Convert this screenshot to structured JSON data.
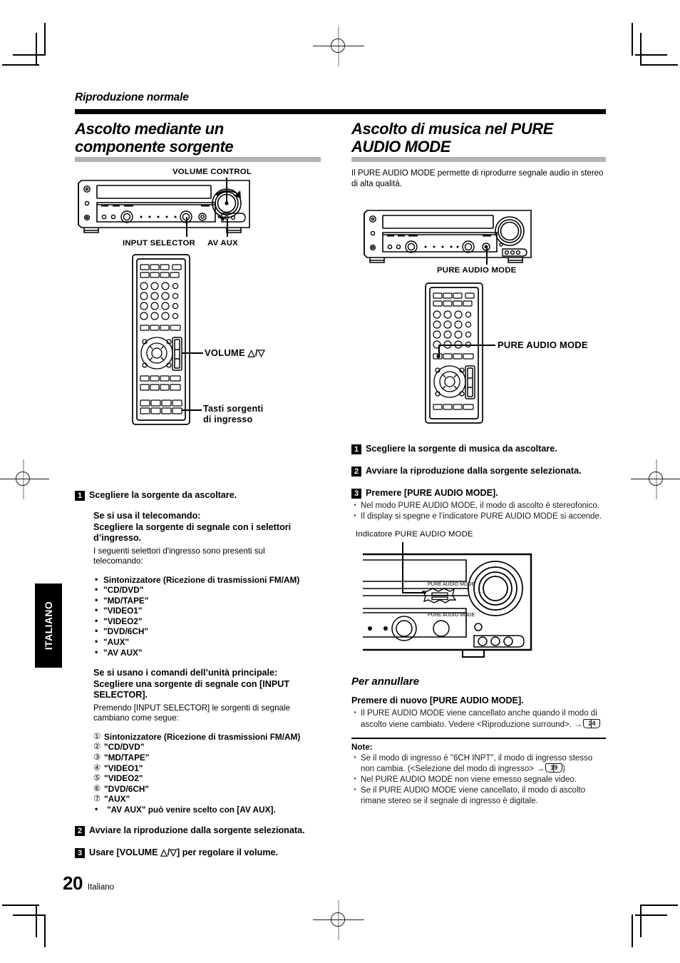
{
  "page": {
    "running_head": "Riproduzione normale",
    "folio_number": "20",
    "folio_label": "Italiano",
    "side_tab": "ITALIANO"
  },
  "left_column": {
    "title": "Ascolto mediante un\ncomponente sorgente",
    "diagram_labels": {
      "volume_control": "VOLUME CONTROL",
      "input_selector": "INPUT SELECTOR",
      "av_aux": "AV AUX",
      "volume_updown": "VOLUME △/▽",
      "source_buttons": "Tasti  sorgenti\ndi ingresso"
    },
    "step1": {
      "num": "1",
      "text": "Scegliere la sorgente da ascoltare.",
      "remote_heading": "Se si usa il telecomando:\nScegliere la sorgente di segnale con i selettori\nd’ingresso.",
      "remote_body": "I seguenti selettori d'ingresso sono presenti sul\ntelecomando:",
      "remote_items": [
        "Sintonizzatore (Ricezione di trasmissioni FM/AM)",
        "\"CD/DVD\"",
        "\"MD/TAPE\"",
        "\"VIDEO1\"",
        "\"VIDEO2\"",
        "\"DVD/6CH\"",
        "\"AUX\"",
        "\"AV AUX\""
      ],
      "unit_heading": "Se si usano i comandi dell’unità principale:\nScegliere una sorgente di segnale con [INPUT\nSELECTOR].",
      "unit_body": "Premendo [INPUT SELECTOR] le sorgenti di segnale\ncambiano come segue:",
      "unit_items": [
        {
          "marker": "①",
          "text": "Sintonizzatore (Ricezione di trasmissioni FM/AM)"
        },
        {
          "marker": "②",
          "text": "\"CD/DVD\""
        },
        {
          "marker": "③",
          "text": "\"MD/TAPE\""
        },
        {
          "marker": "④",
          "text": "\"VIDEO1\""
        },
        {
          "marker": "⑤",
          "text": "\"VIDEO2\""
        },
        {
          "marker": "⑥",
          "text": "\"DVD/6CH\""
        },
        {
          "marker": "⑦",
          "text": "\"AUX\""
        }
      ],
      "unit_last_bullet": "\"AV AUX\" può venire scelto con [AV AUX]."
    },
    "step2": {
      "num": "2",
      "text": "Avviare la riproduzione dalla sorgente selezionata."
    },
    "step3": {
      "num": "3",
      "text": "Usare [VOLUME △/▽] per regolare il volume."
    }
  },
  "right_column": {
    "title": "Ascolto di musica nel PURE\nAUDIO MODE",
    "intro": "Il PURE AUDIO MODE permette di riprodurre segnale audio in\nstereo di alta qualità.",
    "diagram_labels": {
      "pure_audio_mode_unit": "PURE AUDIO MODE",
      "pure_audio_mode_remote": "PURE AUDIO MODE",
      "indicator_caption": "Indicatore PURE AUDIO MODE",
      "panel_indicator_text": "PURE AUDIO MODE",
      "panel_button_text": "PURE AUDIO MODE"
    },
    "step1": {
      "num": "1",
      "text": "Scegliere la sorgente di musica da ascoltare."
    },
    "step2": {
      "num": "2",
      "text": "Avviare la riproduzione dalla sorgente selezionata."
    },
    "step3": {
      "num": "3",
      "text": "Premere [PURE AUDIO MODE].",
      "bullets": [
        "Nel modo PURE AUDIO MODE, il modo di ascolto è stereofonico.",
        "Il display si spegne e l’indicatore PURE AUDIO MODE si accende."
      ]
    },
    "cancel_heading": "Per annullare",
    "cancel_bold": "Premere di nuovo [PURE AUDIO MODE].",
    "cancel_bullet_pre": "Il PURE AUDIO MODE viene cancellato anche quando il modo di ascolto viene cambiato. Vedere <Riproduzione surround>.",
    "cancel_bullet_ref": "24",
    "notes_heading": "Note:",
    "notes": [
      {
        "pre": "Se il modo di ingresso è \"6CH INPT\", il modo di ingresso stesso non cambia. (<Selezione del modo di ingresso>",
        "ref": "19",
        "post": ")"
      },
      {
        "pre": "Nel PURE AUDIO MODE non viene emesso segnale video.",
        "ref": "",
        "post": ""
      },
      {
        "pre": "Se il PURE AUDIO MODE viene cancellato, il modo di ascolto rimane stereo se il segnale di ingresso è digitale.",
        "ref": "",
        "post": ""
      }
    ]
  },
  "colors": {
    "rule_black": "#000000",
    "rule_gray": "#b3b3b3",
    "tab_black": "#000000"
  }
}
